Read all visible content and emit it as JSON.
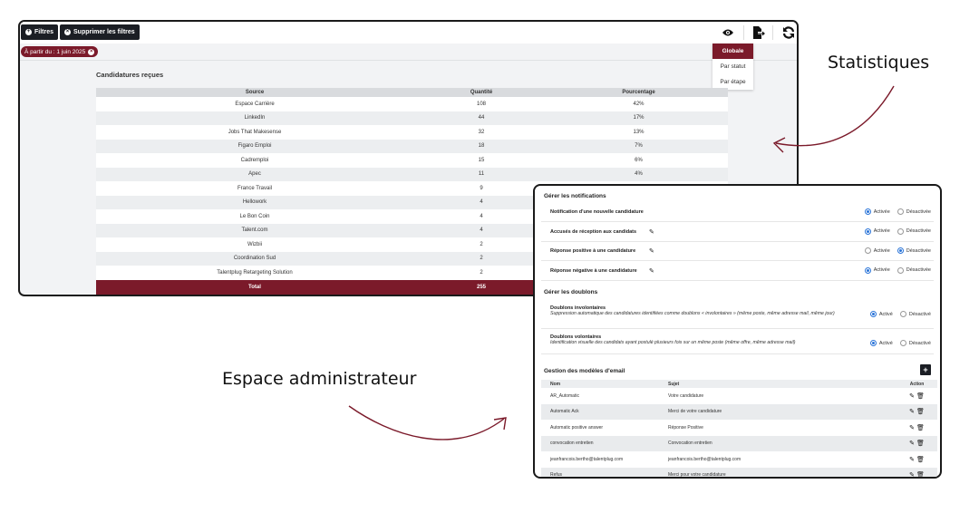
{
  "stats": {
    "filters_button": "Filtres",
    "clear_filters_button": "Supprimer les filtres",
    "filter_chip": "À partir du : 1 juin 2025",
    "view_menu": [
      "Globale",
      "Par statut",
      "Par étape"
    ],
    "section_title": "Candidatures reçues",
    "headers": [
      "Source",
      "Quantité",
      "Pourcentage"
    ],
    "rows": [
      [
        "Espace Carrière",
        "108",
        "42%"
      ],
      [
        "LinkedIn",
        "44",
        "17%"
      ],
      [
        "Jobs That Makesense",
        "32",
        "13%"
      ],
      [
        "Figaro Emploi",
        "18",
        "7%"
      ],
      [
        "Cadremploi",
        "15",
        "6%"
      ],
      [
        "Apec",
        "11",
        "4%"
      ],
      [
        "France Travail",
        "9",
        ""
      ],
      [
        "Hellowork",
        "4",
        ""
      ],
      [
        "Le Bon Coin",
        "4",
        ""
      ],
      [
        "Talent.com",
        "4",
        ""
      ],
      [
        "Wizbii",
        "2",
        ""
      ],
      [
        "Coordination Sud",
        "2",
        ""
      ],
      [
        "Talentplug Retargeting Solution",
        "2",
        ""
      ]
    ],
    "total": [
      "Total",
      "255",
      ""
    ]
  },
  "admin": {
    "notifications_title": "Gérer les notifications",
    "notifications": [
      {
        "label": "Notification d'une nouvelle candidature",
        "editable": false,
        "active": true
      },
      {
        "label": "Accusés de réception aux candidats",
        "editable": true,
        "active": true
      },
      {
        "label": "Réponse positive à une candidature",
        "editable": true,
        "active": false
      },
      {
        "label": "Réponse négative à une candidature",
        "editable": true,
        "active": true
      }
    ],
    "on_label": "Activée",
    "off_label": "Désactivée",
    "duplicates_title": "Gérer les doublons",
    "duplicates": [
      {
        "label": "Doublons involontaires",
        "desc": "Suppression automatique des candidatures identifiées comme doublons « involontaires » (même poste, même adresse mail, même jour)",
        "active": true
      },
      {
        "label": "Doublons volontaires",
        "desc": "Identification visuelle des candidats ayant postulé plusieurs fois sur un même poste (même offre, même adresse mail)",
        "active": true
      }
    ],
    "dup_on_label": "Activé",
    "dup_off_label": "Désactivé",
    "emails_title": "Gestion des modèles d'email",
    "email_headers": [
      "Nom",
      "Sujet",
      "Action"
    ],
    "emails": [
      [
        "AR_Automatic",
        "Votre candidature"
      ],
      [
        "Automatic Ack",
        "Merci de votre candidature"
      ],
      [
        "Automatic positive answer",
        "Réponse Positive"
      ],
      [
        "convocation entretien",
        "Convocation entretien"
      ],
      [
        "jeanfrancois.bertho@talentplug.com",
        "jeanfrancois.bertho@talentplug.com"
      ],
      [
        "Refus",
        "Merci pour votre candidature"
      ]
    ]
  },
  "annotations": {
    "stats_label": "Statistiques",
    "admin_label": "Espace administrateur"
  },
  "colors": {
    "brand": "#7b1a2a",
    "dark": "#1b1e24",
    "radio_on": "#2a74d8"
  }
}
